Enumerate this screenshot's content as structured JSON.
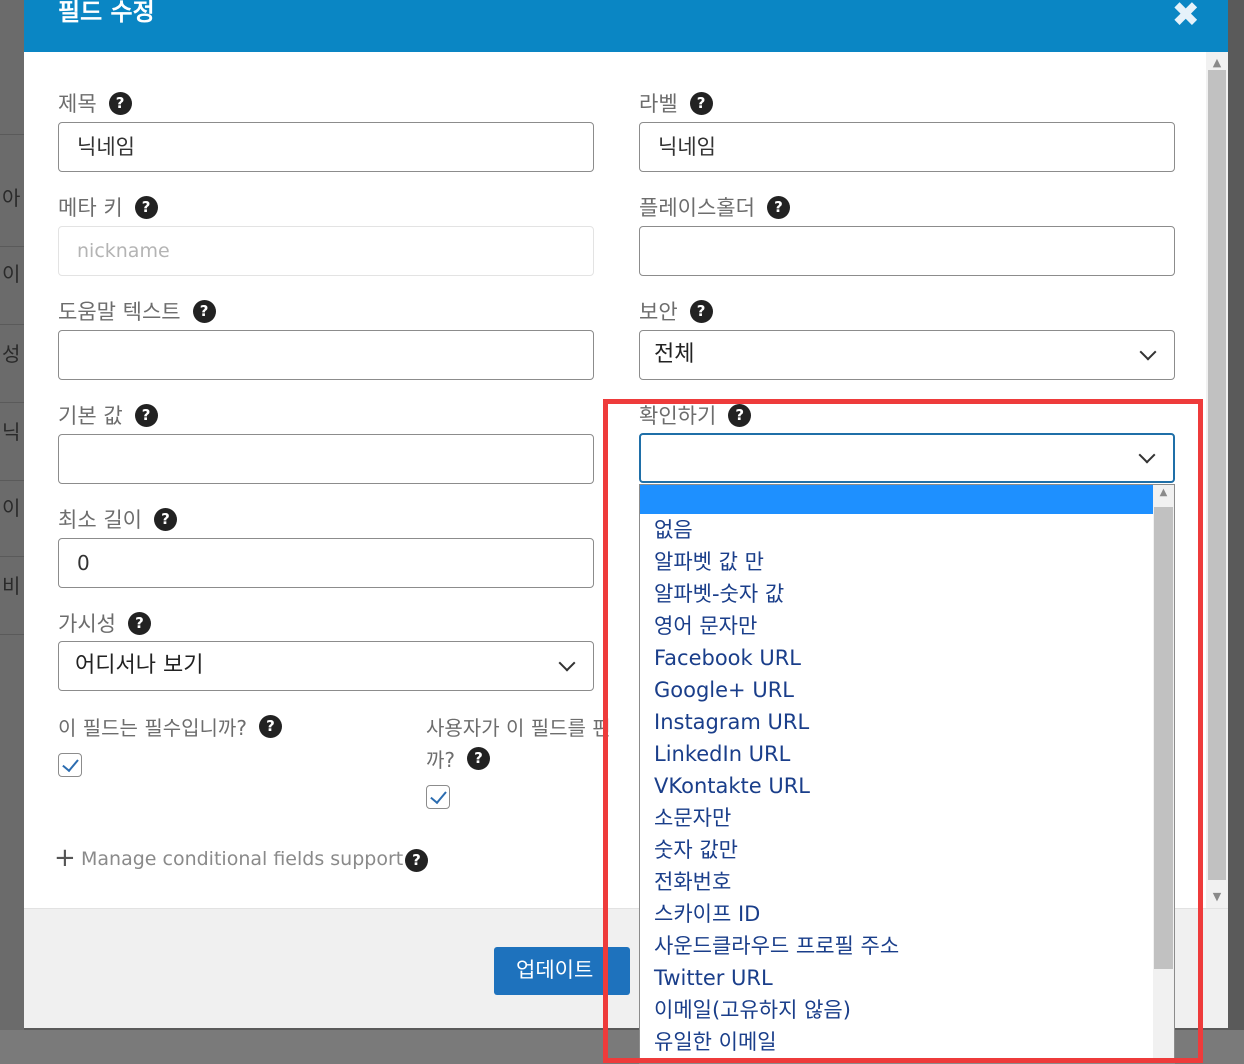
{
  "modal": {
    "title": "필드 수정",
    "close_glyph": "✖"
  },
  "fields": {
    "title": {
      "label": "제목",
      "value": "닉네임"
    },
    "label": {
      "label": "라벨",
      "value": "닉네임"
    },
    "meta_key": {
      "label": "메타 키",
      "placeholder": "nickname"
    },
    "placeholder": {
      "label": "플레이스홀더",
      "value": ""
    },
    "help_text": {
      "label": "도움말 텍스트",
      "value": ""
    },
    "privacy": {
      "label": "보안",
      "value": "전체"
    },
    "default_value": {
      "label": "기본 값",
      "value": ""
    },
    "validate": {
      "label": "확인하기",
      "value": ""
    },
    "min_length": {
      "label": "최소 길이",
      "value": "0"
    },
    "visibility": {
      "label": "가시성",
      "value": "어디서나 보기"
    },
    "required": {
      "label": "이 필드는 필수입니까?",
      "checked": true
    },
    "editable": {
      "label_line1": "사용자가 이 필드를 편",
      "label_line2": "까?",
      "checked": true
    }
  },
  "help_glyph": "?",
  "conditional": {
    "plus": "+",
    "label": "Manage conditional fields support"
  },
  "footer": {
    "update_label": "업데이트"
  },
  "validate_options": [
    "",
    "없음",
    "알파벳 값 만",
    "알파벳-숫자 값",
    "영어 문자만",
    "Facebook URL",
    "Google+ URL",
    "Instagram URL",
    "LinkedIn URL",
    "VKontakte URL",
    "소문자만",
    "숫자 값만",
    "전화번호",
    "스카이프 ID",
    "사운드클라우드 프로필 주소",
    "Twitter URL",
    "이메일(고유하지 않음)",
    "유일한 이메일"
  ],
  "background_fragments": [
    "아",
    "이",
    "성",
    "닉",
    "이",
    "비"
  ],
  "colors": {
    "header": "#0a86c4",
    "button": "#1e72bd",
    "highlight": "#1e90ff",
    "annotation": "#ee3b3b"
  }
}
